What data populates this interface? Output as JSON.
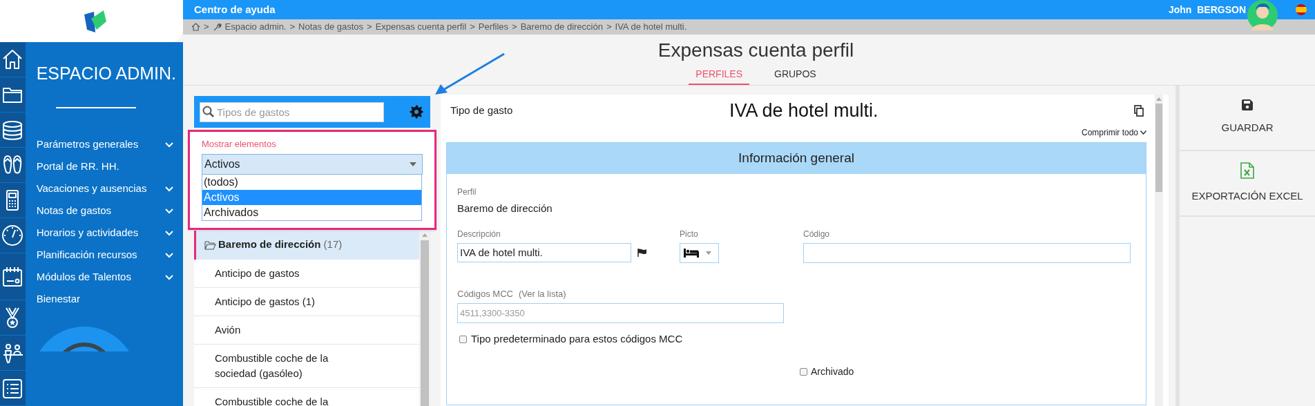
{
  "top_bar": {
    "title": "Centro de ayuda",
    "user_name": "John  BERGSON"
  },
  "breadcrumb": {
    "separator": ">",
    "items": [
      "Espacio admin.",
      "Notas de gastos",
      "Expensas cuenta perfil",
      "Perfiles",
      "Baremo de dirección",
      "IVA de hotel multi."
    ]
  },
  "sidebar": {
    "title": "ESPACIO ADMIN.",
    "items": [
      {
        "label": "Parámetros generales",
        "expandable": true
      },
      {
        "label": "Portal de RR. HH.",
        "expandable": false
      },
      {
        "label": "Vacaciones y ausencias",
        "expandable": true
      },
      {
        "label": "Notas de gastos",
        "expandable": true
      },
      {
        "label": "Horarios y actividades",
        "expandable": true
      },
      {
        "label": "Planificación recursos",
        "expandable": true
      },
      {
        "label": "Módulos de Talentos",
        "expandable": true
      },
      {
        "label": "Bienestar",
        "expandable": false
      }
    ]
  },
  "page": {
    "title": "Expensas cuenta perfil",
    "tabs": [
      {
        "label": "PERFILES",
        "selected": true
      },
      {
        "label": "GRUPOS",
        "selected": false
      }
    ]
  },
  "list_panel": {
    "search": {
      "placeholder": "Tipos de gastos"
    },
    "filter": {
      "label": "Mostrar elementos",
      "value": "Activos",
      "options": [
        {
          "label": "(todos)",
          "selected": false
        },
        {
          "label": "Activos",
          "selected": true
        },
        {
          "label": "Archivados",
          "selected": false
        }
      ]
    },
    "group": {
      "label": "Baremo de dirección",
      "count": "(17)",
      "selected": true
    },
    "items": [
      "Anticipo de gastos",
      "Anticipo de gastos (1)",
      "Avión",
      "Combustible coche de la sociedad (gasóleo)",
      "Combustible coche de la"
    ]
  },
  "detail": {
    "label": "Tipo de gasto",
    "title": "IVA de hotel multi.",
    "collapse_all": "Comprimir todo",
    "section": {
      "title": "Información general",
      "profile_label": "Perfil",
      "profile_value": "Baremo de dirección",
      "description": {
        "label": "Descripción",
        "value": "IVA de hotel multi."
      },
      "picto_label": "Picto",
      "code_label": "Código",
      "mcc": {
        "label": "Códigos MCC",
        "link": "(Ver la lista)",
        "placeholder": "4511,3300-3350"
      },
      "default_type": {
        "label": "Tipo predeterminado para estos códigos MCC",
        "checked": false
      },
      "archived": {
        "label": "Archivado",
        "checked": false
      }
    }
  },
  "actions": [
    {
      "kind": "save",
      "label": "GUARDAR"
    },
    {
      "kind": "excel",
      "label": "EXPORTACIÓN EXCEL"
    }
  ]
}
